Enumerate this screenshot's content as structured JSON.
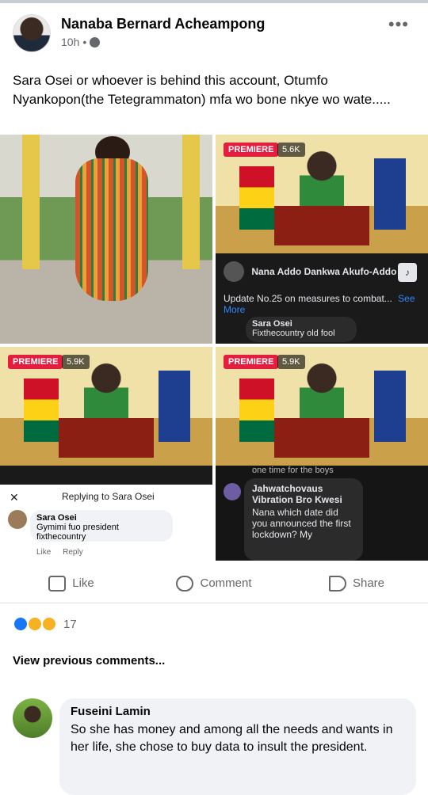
{
  "post": {
    "author": "Nanaba Bernard Acheampong",
    "time": "10h",
    "audience_icon": "globe-icon",
    "more_icon": "more-horizontal-icon",
    "text": "Sara Osei or whoever is behind this account, Otumfo Nyankopon(the Tetegrammaton) mfa wo bone nkye wo wate....."
  },
  "images": {
    "top_right": {
      "premiere_label": "PREMIERE",
      "views": "5.6K",
      "page_name": "Nana Addo Dankwa Akufo-Addo",
      "caption": "Update No.25 on measures to combat...",
      "see_more": "See More",
      "comment_author": "Sara Osei",
      "comment_text": "Fixthecountry old fool"
    },
    "bottom_left": {
      "premiere_label": "PREMIERE",
      "views": "5.9K",
      "reply_header": "Replying to Sara Osei",
      "reply_author": "Sara Osei",
      "reply_text": "Gymimi fuo president fixthecountry",
      "like_label": "Like",
      "reply_label": "Reply"
    },
    "bottom_right": {
      "premiere_label": "PREMIERE",
      "views": "5.9K",
      "overflow_text": "one time for the boys",
      "comment_author": "Jahwatchovaus Vibration Bro Kwesi",
      "comment_text": "Nana which date did you announced the first lockdown? My"
    }
  },
  "actions": {
    "like": "Like",
    "comment": "Comment",
    "share": "Share"
  },
  "reactions": {
    "count": "17",
    "types": [
      "like",
      "wow",
      "haha"
    ]
  },
  "comments": {
    "view_previous": "View previous comments...",
    "items": [
      {
        "author": "Fuseini Lamin",
        "text": "So she has money and among all the needs and wants in her life, she chose to buy data to insult the president."
      }
    ]
  }
}
